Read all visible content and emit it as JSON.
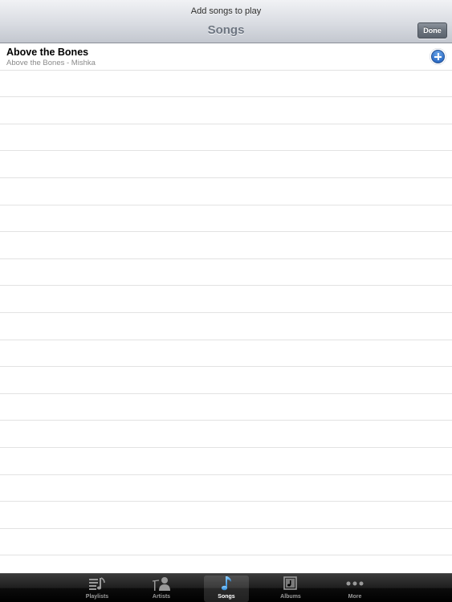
{
  "header": {
    "prompt": "Add songs to play",
    "title": "Songs",
    "done_label": "Done"
  },
  "songs": [
    {
      "title": "Above the Bones",
      "subtitle": "Above the Bones - Mishka"
    }
  ],
  "tabbar": {
    "tabs": [
      {
        "label": "Playlists",
        "icon": "playlists-icon",
        "selected": false
      },
      {
        "label": "Artists",
        "icon": "artists-icon",
        "selected": false
      },
      {
        "label": "Songs",
        "icon": "music-note-icon",
        "selected": true
      },
      {
        "label": "Albums",
        "icon": "albums-icon",
        "selected": false
      },
      {
        "label": "More",
        "icon": "more-icon",
        "selected": false
      }
    ]
  },
  "colors": {
    "accent": "#3a8fd9",
    "title_text": "#6e7682",
    "add_button": "#2f6fc9"
  }
}
